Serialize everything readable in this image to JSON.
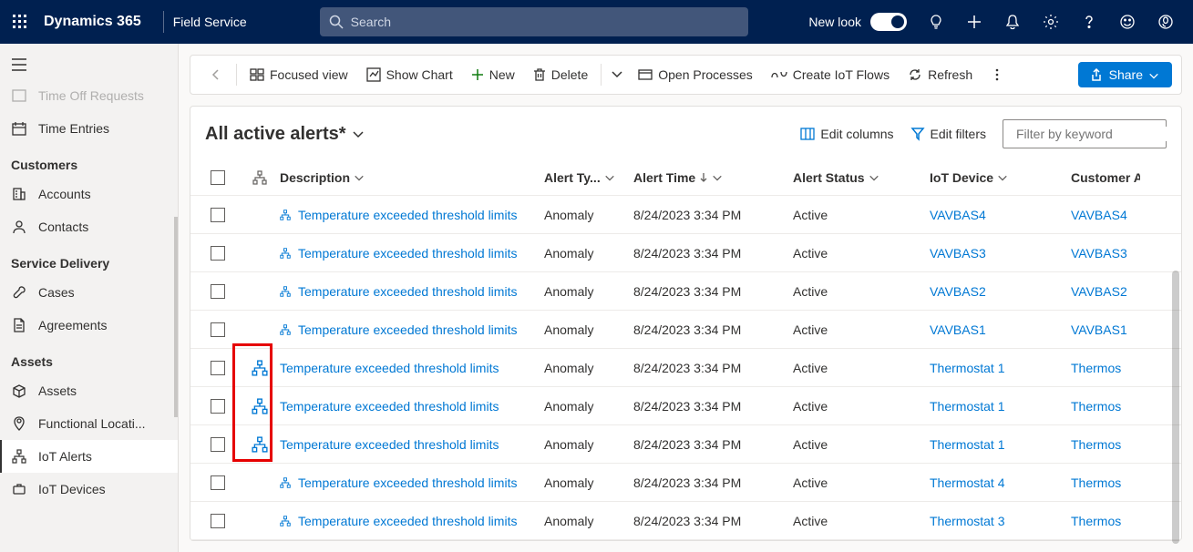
{
  "header": {
    "brand": "Dynamics 365",
    "app": "Field Service",
    "search_placeholder": "Search",
    "new_look": "New look"
  },
  "sidebar": {
    "cut_item": "Time Off Requests",
    "time_entries": "Time Entries",
    "sections": {
      "customers": "Customers",
      "service_delivery": "Service Delivery",
      "assets": "Assets"
    },
    "items": {
      "accounts": "Accounts",
      "contacts": "Contacts",
      "cases": "Cases",
      "agreements": "Agreements",
      "assets": "Assets",
      "functional": "Functional Locati...",
      "iot_alerts": "IoT Alerts",
      "iot_devices": "IoT Devices"
    }
  },
  "commands": {
    "focused_view": "Focused view",
    "show_chart": "Show Chart",
    "new": "New",
    "delete": "Delete",
    "open_processes": "Open Processes",
    "create_iot_flows": "Create IoT Flows",
    "refresh": "Refresh",
    "share": "Share"
  },
  "view": {
    "title": "All active alerts*",
    "edit_columns": "Edit columns",
    "edit_filters": "Edit filters",
    "filter_placeholder": "Filter by keyword"
  },
  "columns": {
    "description": "Description",
    "alert_type": "Alert Ty...",
    "alert_time": "Alert Time",
    "alert_status": "Alert Status",
    "iot_device": "IoT Device",
    "customer_asset": "Customer A"
  },
  "rows": [
    {
      "desc": "Temperature exceeded threshold limits",
      "type": "Anomaly",
      "time": "8/24/2023 3:34 PM",
      "status": "Active",
      "device": "VAVBAS4",
      "asset": "VAVBAS4",
      "hier": false,
      "small": true
    },
    {
      "desc": "Temperature exceeded threshold limits",
      "type": "Anomaly",
      "time": "8/24/2023 3:34 PM",
      "status": "Active",
      "device": "VAVBAS3",
      "asset": "VAVBAS3",
      "hier": false,
      "small": true
    },
    {
      "desc": "Temperature exceeded threshold limits",
      "type": "Anomaly",
      "time": "8/24/2023 3:34 PM",
      "status": "Active",
      "device": "VAVBAS2",
      "asset": "VAVBAS2",
      "hier": false,
      "small": true
    },
    {
      "desc": "Temperature exceeded threshold limits",
      "type": "Anomaly",
      "time": "8/24/2023 3:34 PM",
      "status": "Active",
      "device": "VAVBAS1",
      "asset": "VAVBAS1",
      "hier": false,
      "small": true
    },
    {
      "desc": "Temperature exceeded threshold limits",
      "type": "Anomaly",
      "time": "8/24/2023 3:34 PM",
      "status": "Active",
      "device": "Thermostat 1",
      "asset": "Thermos",
      "hier": true,
      "small": false
    },
    {
      "desc": "Temperature exceeded threshold limits",
      "type": "Anomaly",
      "time": "8/24/2023 3:34 PM",
      "status": "Active",
      "device": "Thermostat 1",
      "asset": "Thermos",
      "hier": true,
      "small": false
    },
    {
      "desc": "Temperature exceeded threshold limits",
      "type": "Anomaly",
      "time": "8/24/2023 3:34 PM",
      "status": "Active",
      "device": "Thermostat 1",
      "asset": "Thermos",
      "hier": true,
      "small": false
    },
    {
      "desc": "Temperature exceeded threshold limits",
      "type": "Anomaly",
      "time": "8/24/2023 3:34 PM",
      "status": "Active",
      "device": "Thermostat 4",
      "asset": "Thermos",
      "hier": false,
      "small": true
    },
    {
      "desc": "Temperature exceeded threshold limits",
      "type": "Anomaly",
      "time": "8/24/2023 3:34 PM",
      "status": "Active",
      "device": "Thermostat 3",
      "asset": "Thermos",
      "hier": false,
      "small": true
    }
  ]
}
